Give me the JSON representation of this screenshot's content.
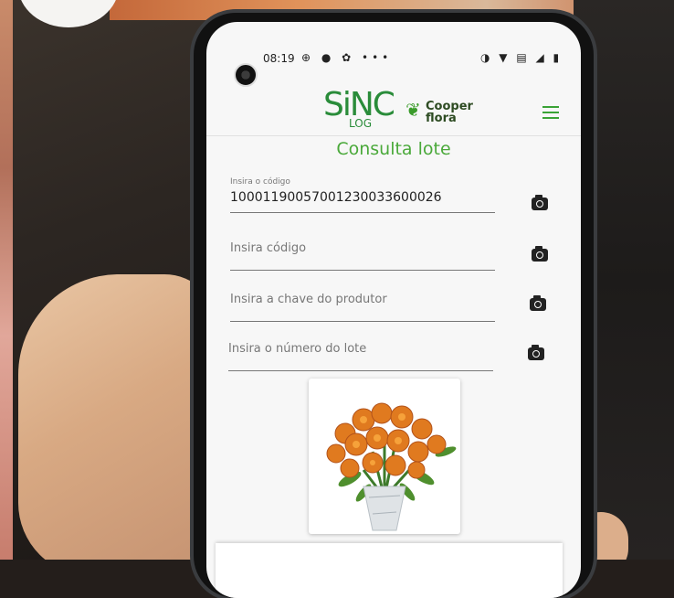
{
  "status_bar": {
    "time": "08:19",
    "left_icons": "⊕ ● ✿ •••",
    "right_icons": "◑ ▼ ▤ ◢ ▮"
  },
  "header": {
    "logo_main": "SiNC",
    "logo_sub": "LOG",
    "partner_line1": "Cooper",
    "partner_line2": "flora",
    "menu_icon": "hamburger-menu-icon"
  },
  "page": {
    "title": "Consulta lote"
  },
  "form": {
    "fields": [
      {
        "label": "Insira o código",
        "value": "10001190057001230033600026",
        "placeholder": ""
      },
      {
        "label": "",
        "value": "",
        "placeholder": "Insira código"
      },
      {
        "label": "",
        "value": "",
        "placeholder": "Insira a chave do produtor"
      },
      {
        "label": "",
        "value": "",
        "placeholder": "Insira o número do lote"
      }
    ]
  },
  "colors": {
    "brand_green": "#4aa93a",
    "logo_green": "#2a8c3a",
    "flower_orange": "#e07a1f"
  }
}
